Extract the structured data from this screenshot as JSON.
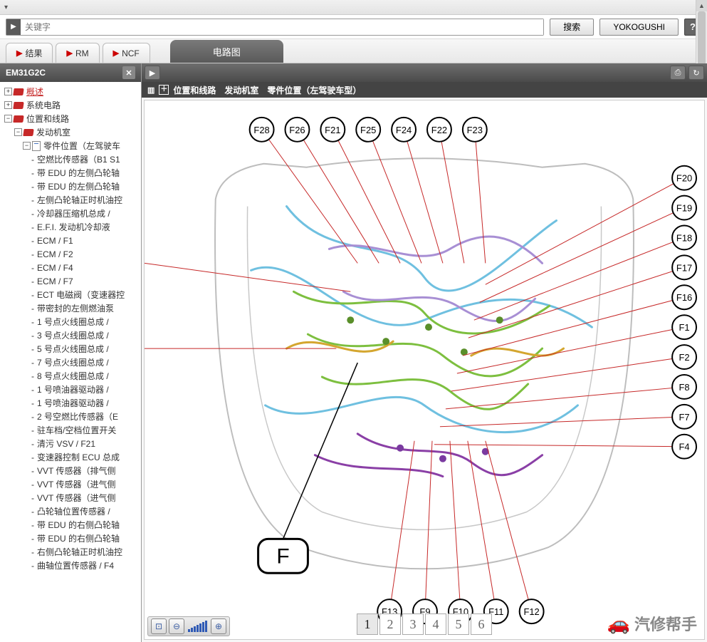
{
  "search": {
    "placeholder": "关键字",
    "search_btn": "搜索",
    "yoko_btn": "YOKOGUSHI"
  },
  "tabs": {
    "sub": [
      {
        "label": "结果"
      },
      {
        "label": "RM"
      },
      {
        "label": "NCF"
      }
    ],
    "main": "电路图"
  },
  "left": {
    "title": "EM31G2C",
    "tree": {
      "overview": "概述",
      "system_circuit": "系统电路",
      "location_wiring": "位置和线路",
      "engine_room": "发动机室",
      "part_location": "零件位置（左驾驶车",
      "leaves": [
        "空燃比传感器（B1 S1",
        "带 EDU 的左侧凸轮轴",
        "带 EDU 的左侧凸轮轴",
        "左侧凸轮轴正时机油控",
        "冷却器压缩机总成 /",
        "E.F.I. 发动机冷却液",
        "ECM / F1",
        "ECM / F2",
        "ECM / F4",
        "ECM / F7",
        "ECT 电磁阀（变速器控",
        "带密封的左侧燃油泵",
        "1 号点火线圈总成 /",
        "3 号点火线圈总成 /",
        "5 号点火线圈总成 /",
        "7 号点火线圈总成 /",
        "8 号点火线圈总成 /",
        "1 号喷油器驱动器 /",
        "1 号喷油器驱动器 /",
        "2 号空燃比传感器（E",
        "驻车档/空档位置开关",
        "清污 VSV / F21",
        "变速器控制 ECU 总成",
        "VVT 传感器（排气侧",
        "VVT 传感器（进气侧",
        "VVT 传感器（进气侧",
        "凸轮轴位置传感器 /",
        "带 EDU 的右侧凸轮轴",
        "带 EDU 的右侧凸轮轴",
        "右侧凸轮轴正时机油控",
        "曲轴位置传感器 / F4"
      ]
    }
  },
  "breadcrumb": {
    "icon": "＋",
    "path": "位置和线路　发动机室　零件位置（左驾驶车型）"
  },
  "diagram": {
    "top_labels": [
      "F28",
      "F26",
      "F21",
      "F25",
      "F24",
      "F22",
      "F23"
    ],
    "right_labels": [
      "F20",
      "F19",
      "F18",
      "F17",
      "F16",
      "F1",
      "F2",
      "F8",
      "F7",
      "F4"
    ],
    "bottom_labels": [
      "F13",
      "F9",
      "F10",
      "F11",
      "F12"
    ],
    "big_label": "F"
  },
  "pager": [
    "1",
    "2",
    "3",
    "4",
    "5",
    "6"
  ],
  "watermark": "汽修帮手"
}
